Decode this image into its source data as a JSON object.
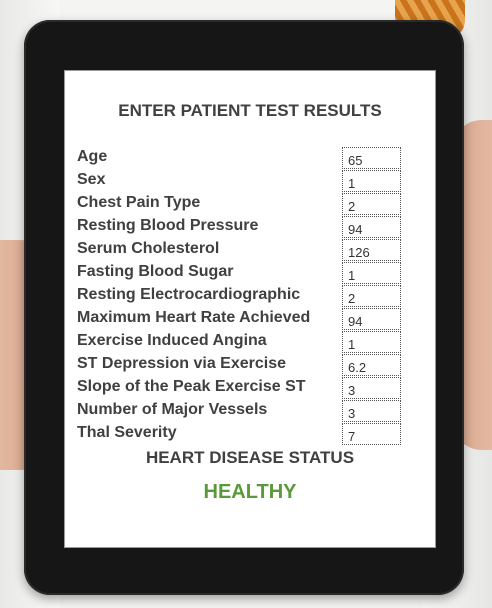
{
  "form": {
    "title": "ENTER PATIENT TEST RESULTS",
    "fields": [
      {
        "label": "Age",
        "value": "65"
      },
      {
        "label": "Sex",
        "value": "1"
      },
      {
        "label": "Chest Pain Type",
        "value": "2"
      },
      {
        "label": "Resting Blood Pressure",
        "value": "94"
      },
      {
        "label": "Serum Cholesterol",
        "value": "126"
      },
      {
        "label": "Fasting Blood Sugar",
        "value": "1"
      },
      {
        "label": "Resting Electrocardiographic",
        "value": "2"
      },
      {
        "label": "Maximum Heart Rate Achieved",
        "value": "94"
      },
      {
        "label": "Exercise Induced Angina",
        "value": "1"
      },
      {
        "label": "ST Depression via Exercise",
        "value": "6.2"
      },
      {
        "label": "Slope of the Peak Exercise ST",
        "value": "3"
      },
      {
        "label": "Number of Major Vessels",
        "value": "3"
      },
      {
        "label": "Thal Severity",
        "value": "7"
      }
    ]
  },
  "result": {
    "label": "HEART DISEASE STATUS",
    "value": "HEALTHY",
    "value_color": "#5a9a3a"
  }
}
